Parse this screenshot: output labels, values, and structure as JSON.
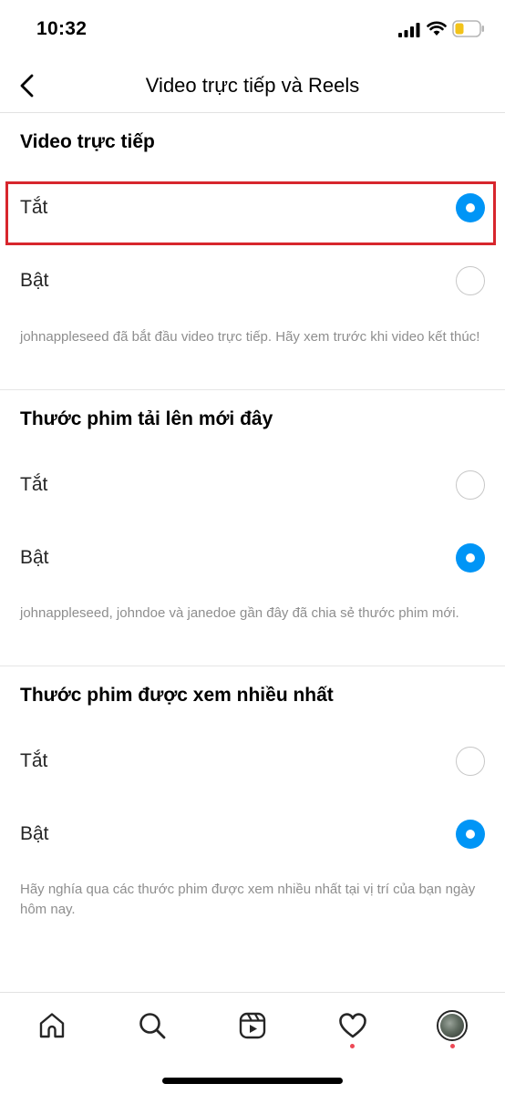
{
  "status_bar": {
    "time": "10:32"
  },
  "header": {
    "title": "Video trực tiếp và Reels"
  },
  "sections": [
    {
      "title": "Video trực tiếp",
      "options": [
        {
          "label": "Tắt",
          "selected": true
        },
        {
          "label": "Bật",
          "selected": false
        }
      ],
      "description": "johnappleseed đã bắt đầu video trực tiếp. Hãy xem trước khi video kết thúc!"
    },
    {
      "title": "Thước phim tải lên mới đây",
      "options": [
        {
          "label": "Tắt",
          "selected": false
        },
        {
          "label": "Bật",
          "selected": true
        }
      ],
      "description": "johnappleseed, johndoe và janedoe gần đây đã chia sẻ thước phim mới."
    },
    {
      "title": "Thước phim được xem nhiều nhất",
      "options": [
        {
          "label": "Tắt",
          "selected": false
        },
        {
          "label": "Bật",
          "selected": true
        }
      ],
      "description": "Hãy nghía qua các thước phim được xem nhiều nhất tại vị trí của bạn ngày hôm nay."
    }
  ],
  "colors": {
    "accent": "#0095f6",
    "highlight": "#d7262d",
    "notification_dot": "#ed4956"
  },
  "bottom_nav": {
    "items": [
      {
        "icon": "home-icon"
      },
      {
        "icon": "search-icon"
      },
      {
        "icon": "reels-icon"
      },
      {
        "icon": "heart-icon",
        "badge": true
      },
      {
        "icon": "profile-avatar",
        "badge": true
      }
    ]
  }
}
